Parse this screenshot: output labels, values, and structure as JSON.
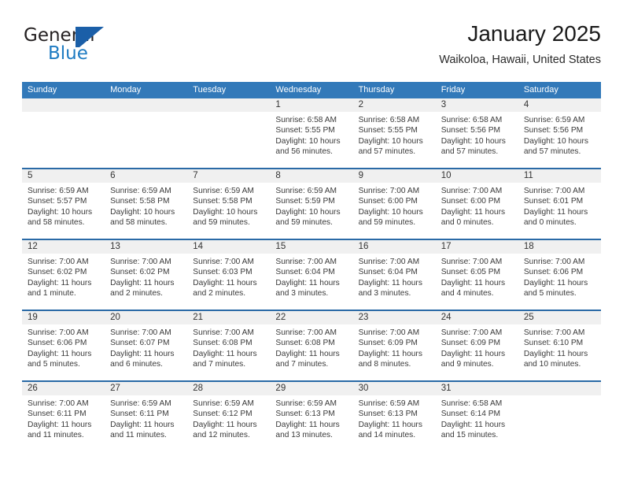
{
  "brand": {
    "name_part1": "General",
    "name_part2": "Blue",
    "logo_icon": "general-blue-triangle-logo"
  },
  "header": {
    "title": "January 2025",
    "subtitle": "Waikoloa, Hawaii, United States"
  },
  "calendar": {
    "weekday_headers": [
      "Sunday",
      "Monday",
      "Tuesday",
      "Wednesday",
      "Thursday",
      "Friday",
      "Saturday"
    ],
    "colors": {
      "header_blue": "#3279b9",
      "week_separator_blue": "#2a6aa6",
      "date_strip_gray": "#f0f0f0",
      "brand_blue": "#1e7bc2",
      "logo_blue": "#1b5fa8"
    },
    "weeks": [
      [
        {
          "empty": true
        },
        {
          "empty": true
        },
        {
          "empty": true
        },
        {
          "day": "1",
          "sunrise": "Sunrise: 6:58 AM",
          "sunset": "Sunset: 5:55 PM",
          "daylight_1": "Daylight: 10 hours",
          "daylight_2": "and 56 minutes."
        },
        {
          "day": "2",
          "sunrise": "Sunrise: 6:58 AM",
          "sunset": "Sunset: 5:55 PM",
          "daylight_1": "Daylight: 10 hours",
          "daylight_2": "and 57 minutes."
        },
        {
          "day": "3",
          "sunrise": "Sunrise: 6:58 AM",
          "sunset": "Sunset: 5:56 PM",
          "daylight_1": "Daylight: 10 hours",
          "daylight_2": "and 57 minutes."
        },
        {
          "day": "4",
          "sunrise": "Sunrise: 6:59 AM",
          "sunset": "Sunset: 5:56 PM",
          "daylight_1": "Daylight: 10 hours",
          "daylight_2": "and 57 minutes."
        }
      ],
      [
        {
          "day": "5",
          "sunrise": "Sunrise: 6:59 AM",
          "sunset": "Sunset: 5:57 PM",
          "daylight_1": "Daylight: 10 hours",
          "daylight_2": "and 58 minutes."
        },
        {
          "day": "6",
          "sunrise": "Sunrise: 6:59 AM",
          "sunset": "Sunset: 5:58 PM",
          "daylight_1": "Daylight: 10 hours",
          "daylight_2": "and 58 minutes."
        },
        {
          "day": "7",
          "sunrise": "Sunrise: 6:59 AM",
          "sunset": "Sunset: 5:58 PM",
          "daylight_1": "Daylight: 10 hours",
          "daylight_2": "and 59 minutes."
        },
        {
          "day": "8",
          "sunrise": "Sunrise: 6:59 AM",
          "sunset": "Sunset: 5:59 PM",
          "daylight_1": "Daylight: 10 hours",
          "daylight_2": "and 59 minutes."
        },
        {
          "day": "9",
          "sunrise": "Sunrise: 7:00 AM",
          "sunset": "Sunset: 6:00 PM",
          "daylight_1": "Daylight: 10 hours",
          "daylight_2": "and 59 minutes."
        },
        {
          "day": "10",
          "sunrise": "Sunrise: 7:00 AM",
          "sunset": "Sunset: 6:00 PM",
          "daylight_1": "Daylight: 11 hours",
          "daylight_2": "and 0 minutes."
        },
        {
          "day": "11",
          "sunrise": "Sunrise: 7:00 AM",
          "sunset": "Sunset: 6:01 PM",
          "daylight_1": "Daylight: 11 hours",
          "daylight_2": "and 0 minutes."
        }
      ],
      [
        {
          "day": "12",
          "sunrise": "Sunrise: 7:00 AM",
          "sunset": "Sunset: 6:02 PM",
          "daylight_1": "Daylight: 11 hours",
          "daylight_2": "and 1 minute."
        },
        {
          "day": "13",
          "sunrise": "Sunrise: 7:00 AM",
          "sunset": "Sunset: 6:02 PM",
          "daylight_1": "Daylight: 11 hours",
          "daylight_2": "and 2 minutes."
        },
        {
          "day": "14",
          "sunrise": "Sunrise: 7:00 AM",
          "sunset": "Sunset: 6:03 PM",
          "daylight_1": "Daylight: 11 hours",
          "daylight_2": "and 2 minutes."
        },
        {
          "day": "15",
          "sunrise": "Sunrise: 7:00 AM",
          "sunset": "Sunset: 6:04 PM",
          "daylight_1": "Daylight: 11 hours",
          "daylight_2": "and 3 minutes."
        },
        {
          "day": "16",
          "sunrise": "Sunrise: 7:00 AM",
          "sunset": "Sunset: 6:04 PM",
          "daylight_1": "Daylight: 11 hours",
          "daylight_2": "and 3 minutes."
        },
        {
          "day": "17",
          "sunrise": "Sunrise: 7:00 AM",
          "sunset": "Sunset: 6:05 PM",
          "daylight_1": "Daylight: 11 hours",
          "daylight_2": "and 4 minutes."
        },
        {
          "day": "18",
          "sunrise": "Sunrise: 7:00 AM",
          "sunset": "Sunset: 6:06 PM",
          "daylight_1": "Daylight: 11 hours",
          "daylight_2": "and 5 minutes."
        }
      ],
      [
        {
          "day": "19",
          "sunrise": "Sunrise: 7:00 AM",
          "sunset": "Sunset: 6:06 PM",
          "daylight_1": "Daylight: 11 hours",
          "daylight_2": "and 5 minutes."
        },
        {
          "day": "20",
          "sunrise": "Sunrise: 7:00 AM",
          "sunset": "Sunset: 6:07 PM",
          "daylight_1": "Daylight: 11 hours",
          "daylight_2": "and 6 minutes."
        },
        {
          "day": "21",
          "sunrise": "Sunrise: 7:00 AM",
          "sunset": "Sunset: 6:08 PM",
          "daylight_1": "Daylight: 11 hours",
          "daylight_2": "and 7 minutes."
        },
        {
          "day": "22",
          "sunrise": "Sunrise: 7:00 AM",
          "sunset": "Sunset: 6:08 PM",
          "daylight_1": "Daylight: 11 hours",
          "daylight_2": "and 7 minutes."
        },
        {
          "day": "23",
          "sunrise": "Sunrise: 7:00 AM",
          "sunset": "Sunset: 6:09 PM",
          "daylight_1": "Daylight: 11 hours",
          "daylight_2": "and 8 minutes."
        },
        {
          "day": "24",
          "sunrise": "Sunrise: 7:00 AM",
          "sunset": "Sunset: 6:09 PM",
          "daylight_1": "Daylight: 11 hours",
          "daylight_2": "and 9 minutes."
        },
        {
          "day": "25",
          "sunrise": "Sunrise: 7:00 AM",
          "sunset": "Sunset: 6:10 PM",
          "daylight_1": "Daylight: 11 hours",
          "daylight_2": "and 10 minutes."
        }
      ],
      [
        {
          "day": "26",
          "sunrise": "Sunrise: 7:00 AM",
          "sunset": "Sunset: 6:11 PM",
          "daylight_1": "Daylight: 11 hours",
          "daylight_2": "and 11 minutes."
        },
        {
          "day": "27",
          "sunrise": "Sunrise: 6:59 AM",
          "sunset": "Sunset: 6:11 PM",
          "daylight_1": "Daylight: 11 hours",
          "daylight_2": "and 11 minutes."
        },
        {
          "day": "28",
          "sunrise": "Sunrise: 6:59 AM",
          "sunset": "Sunset: 6:12 PM",
          "daylight_1": "Daylight: 11 hours",
          "daylight_2": "and 12 minutes."
        },
        {
          "day": "29",
          "sunrise": "Sunrise: 6:59 AM",
          "sunset": "Sunset: 6:13 PM",
          "daylight_1": "Daylight: 11 hours",
          "daylight_2": "and 13 minutes."
        },
        {
          "day": "30",
          "sunrise": "Sunrise: 6:59 AM",
          "sunset": "Sunset: 6:13 PM",
          "daylight_1": "Daylight: 11 hours",
          "daylight_2": "and 14 minutes."
        },
        {
          "day": "31",
          "sunrise": "Sunrise: 6:58 AM",
          "sunset": "Sunset: 6:14 PM",
          "daylight_1": "Daylight: 11 hours",
          "daylight_2": "and 15 minutes."
        },
        {
          "empty": true
        }
      ]
    ]
  }
}
